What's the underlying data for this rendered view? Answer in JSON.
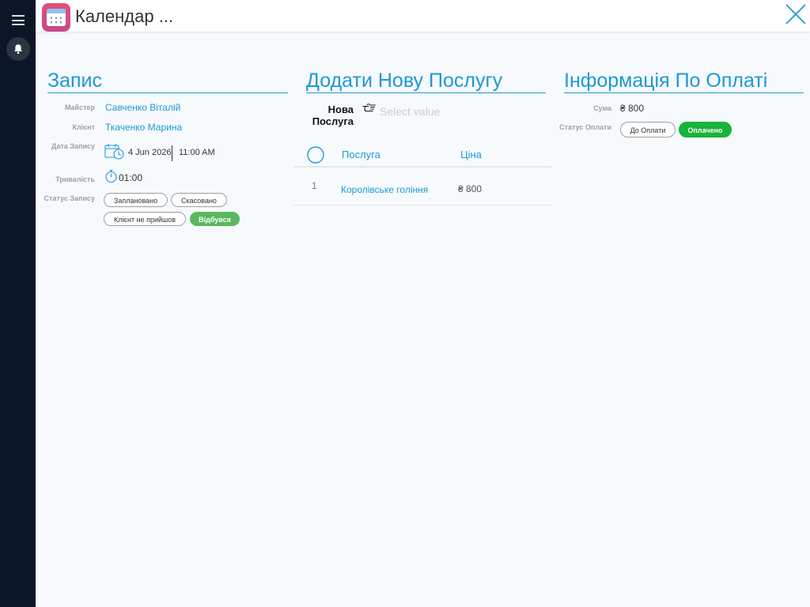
{
  "window": {
    "title": "Календар ..."
  },
  "record": {
    "section_title": "Запис",
    "master_label": "Майстер",
    "master_value": "Савченко Віталій",
    "client_label": "Клієнт",
    "client_value": "Ткаченко Марина",
    "date_label": "Дата Запису",
    "date_value": "4 Jun 2026",
    "time_value": "11:00 AM",
    "duration_label": "Тривалість",
    "duration_value": "01:00",
    "status_label": "Статус Запису",
    "statuses": [
      "Заплановано",
      "Скасовано",
      "Клієнт не прийшов",
      "Відбувся"
    ],
    "active_status": "Відбувся"
  },
  "services": {
    "section_title": "Додати Нову Послугу",
    "new_service_label_line1": "Нова",
    "new_service_label_line2": "Послуга",
    "select_placeholder": "Select value",
    "columns": {
      "service": "Послуга",
      "price": "Ціна"
    },
    "rows": [
      {
        "index": "1",
        "name": "Королівське гоління",
        "price": "₴ 800"
      }
    ]
  },
  "payment": {
    "section_title": "Інформація По Оплаті",
    "sum_label": "Сума",
    "sum_value": "₴ 800",
    "status_label": "Статус Оплати",
    "statuses": [
      "До Оплати",
      "Оплачено"
    ],
    "active_status": "Оплачено"
  },
  "colors": {
    "accent": "#1e98d7",
    "sidebar": "#0b1726",
    "status_done": "#5cb85c",
    "paid": "#18b33a"
  },
  "icons": {
    "menu": "hamburger-menu-icon",
    "bell": "bell-icon",
    "app": "calendar-app-icon",
    "close": "close-icon",
    "date": "calendar-clock-icon",
    "duration": "stopwatch-icon",
    "select": "pointing-hand-icon",
    "select_all": "circle-checkbox-icon"
  }
}
